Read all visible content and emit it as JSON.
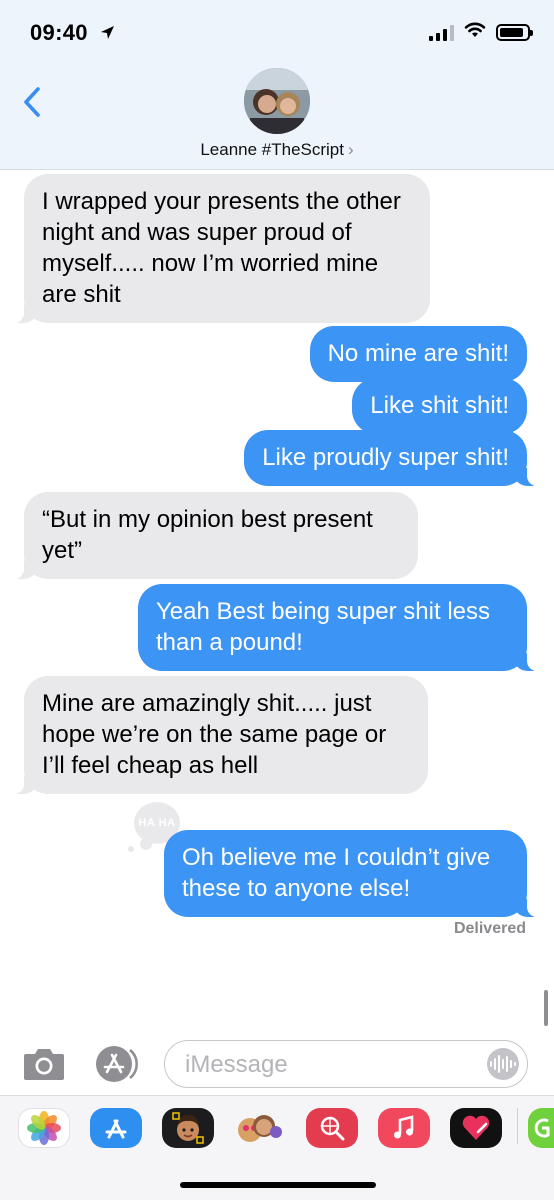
{
  "status_bar": {
    "time": "09:40",
    "icons": [
      "location-arrow-icon",
      "signal-icon",
      "wifi-icon",
      "battery-icon"
    ]
  },
  "header": {
    "back_icon": "chevron-left-icon",
    "contact_name": "Leanne #TheScript",
    "contact_chevron": "›"
  },
  "messages": [
    {
      "direction": "incoming",
      "text": "I wrapped your presents the other night and was super proud of myself..... now I’m worried mine are shit"
    },
    {
      "direction": "outgoing",
      "text": "No mine are shit!"
    },
    {
      "direction": "outgoing",
      "text": "Like shit shit!"
    },
    {
      "direction": "outgoing",
      "text": "Like proudly super shit!"
    },
    {
      "direction": "incoming",
      "text": "“But in my opinion best present yet”"
    },
    {
      "direction": "outgoing",
      "text": "Yeah Best being super shit less than a pound!"
    },
    {
      "direction": "incoming",
      "text": "Mine are amazingly shit..... just hope we’re on the same page or I’ll feel cheap as hell"
    },
    {
      "direction": "outgoing",
      "text": "Oh believe me I couldn’t give these to anyone else!",
      "tapback": "HA HA"
    }
  ],
  "delivery_status": "Delivered",
  "composer": {
    "placeholder": "iMessage",
    "icons": [
      "camera-icon",
      "app-store-icon",
      "audio-waveform-icon"
    ]
  },
  "app_tray": {
    "icons": [
      "photos-icon",
      "app-store-icon",
      "memoji-icon",
      "animoji-icon",
      "web-search-icon",
      "music-icon",
      "heart-icon",
      "partial-app-icon"
    ]
  },
  "colors": {
    "outgoing_bubble": "#3c94f5",
    "incoming_bubble": "#e9e9eb",
    "header_bg": "#edf4fc",
    "back_chevron": "#3a8ef2"
  }
}
